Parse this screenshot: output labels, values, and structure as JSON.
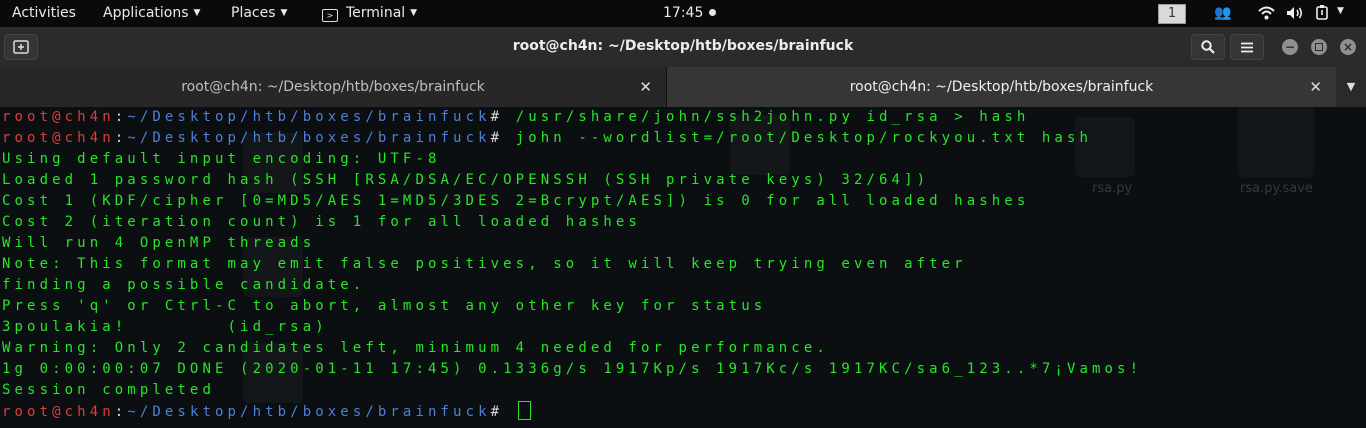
{
  "topbar": {
    "activities": "Activities",
    "applications": "Applications",
    "places": "Places",
    "terminal": "Terminal",
    "clock": "17:45",
    "workspace": "1"
  },
  "window": {
    "title": "root@ch4n: ~/Desktop/htb/boxes/brainfuck"
  },
  "tabs": [
    {
      "label": "root@ch4n: ~/Desktop/htb/boxes/brainfuck",
      "active": false
    },
    {
      "label": "root@ch4n: ~/Desktop/htb/boxes/brainfuck",
      "active": true
    }
  ],
  "prompt": {
    "user_host": "root@ch4n",
    "colon": ":",
    "path": "~/Desktop/htb/boxes/brainfuck",
    "symbol": "#"
  },
  "commands": [
    " /usr/share/john/ssh2john.py id_rsa > hash",
    " john --wordlist=/root/Desktop/rockyou.txt hash"
  ],
  "output": [
    "Using default input encoding: UTF-8",
    "Loaded 1 password hash (SSH [RSA/DSA/EC/OPENSSH (SSH private keys) 32/64])",
    "Cost 1 (KDF/cipher [0=MD5/AES 1=MD5/3DES 2=Bcrypt/AES]) is 0 for all loaded hashes",
    "Cost 2 (iteration count) is 1 for all loaded hashes",
    "Will run 4 OpenMP threads",
    "Note: This format may emit false positives, so it will keep trying even after",
    "finding a possible candidate.",
    "Press 'q' or Ctrl-C to abort, almost any other key for status",
    "3poulakia!        (id_rsa)",
    "Warning: Only 2 candidates left, minimum 4 needed for performance.",
    "1g 0:00:00:07 DONE (2020-01-11 17:45) 0.1336g/s 1917Kp/s 1917Kc/s 1917KC/sa6_123..*7¡Vamos!",
    "Session completed"
  ],
  "desktop_ghosts": [
    "rsa.py",
    "rsa.py.save"
  ],
  "colors": {
    "terminal_bg": "#0c0f12",
    "output_green": "#26e626",
    "prompt_red": "#e23a3a",
    "path_blue": "#4f7fd6"
  }
}
